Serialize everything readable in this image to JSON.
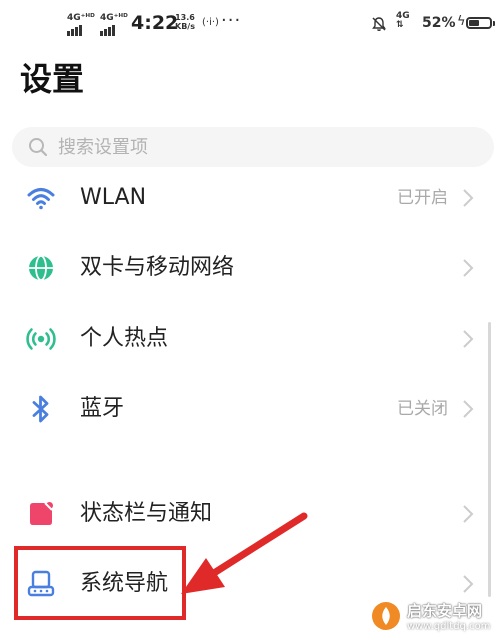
{
  "status_bar": {
    "sim1": "4G⁺ᴴᴰ",
    "sim2": "4G⁺ᴴᴰ",
    "time": "4:22",
    "speed_value": "13.6",
    "speed_unit": "KB/s",
    "hotspot_mini": "(·i·)",
    "more": "···",
    "net": "4G",
    "battery_pct": "52%",
    "battery_level": 0.52
  },
  "page_title": "设置",
  "search": {
    "placeholder": "搜索设置项"
  },
  "items": [
    {
      "label": "WLAN",
      "value": "已开启",
      "icon": "wifi-icon",
      "color": "#4a7fe0"
    },
    {
      "label": "双卡与移动网络",
      "value": "",
      "icon": "globe-icon",
      "color": "#2fbf8f"
    },
    {
      "label": "个人热点",
      "value": "",
      "icon": "hotspot-icon",
      "color": "#2fbf8f"
    },
    {
      "label": "蓝牙",
      "value": "已关闭",
      "icon": "bluetooth-icon",
      "color": "#4a7fe0"
    },
    {
      "label": "状态栏与通知",
      "value": "",
      "icon": "notification-icon",
      "color": "#f0456a"
    },
    {
      "label": "系统导航",
      "value": "",
      "icon": "navigation-icon",
      "color": "#4a7fe0"
    }
  ],
  "annotation": {
    "color": "#e02a2a"
  },
  "watermark": {
    "line1": "启东安卓网",
    "line2": "www.qdltdq.com"
  }
}
